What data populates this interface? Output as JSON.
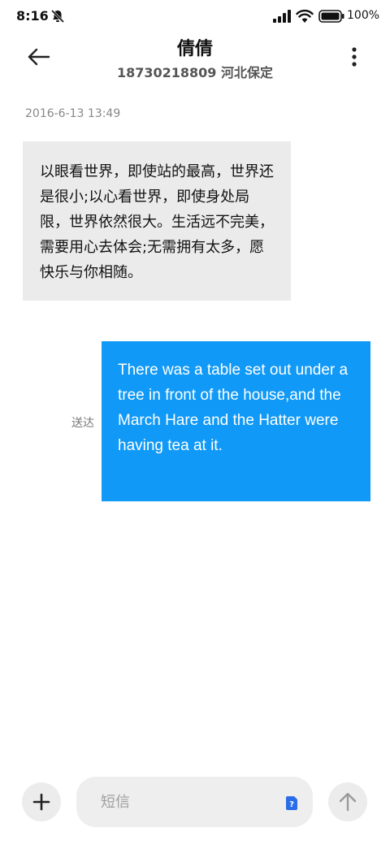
{
  "status_bar": {
    "time": "8:16",
    "battery": "100%",
    "icons": [
      "mute-icon",
      "signal-icon",
      "wifi-icon",
      "battery-icon"
    ]
  },
  "header": {
    "contact_name": "倩倩",
    "contact_detail": "18730218809 河北保定",
    "icons": [
      "back-arrow-icon",
      "more-vertical-icon"
    ]
  },
  "conversation": {
    "timestamp": "2016-6-13 13:49",
    "incoming_message": "以眼看世界，即使站的最高，世界还是很小;以心看世界，即使身处局限，世界依然很大。生活远不完美，需要用心去体会;无需拥有太多，愿快乐与你相随。",
    "outgoing_message": "There was a table set out under a tree in front of the house,and the March Hare and the Hatter were having tea at it.",
    "outgoing_status": "送达"
  },
  "composer": {
    "placeholder": "短信",
    "value": "",
    "icons": [
      "plus-icon",
      "sim-card-icon",
      "send-arrow-icon"
    ]
  },
  "colors": {
    "outgoing_bubble": "#1099f6",
    "incoming_bubble": "#ebebeb",
    "sim_badge": "#2a6de8"
  }
}
